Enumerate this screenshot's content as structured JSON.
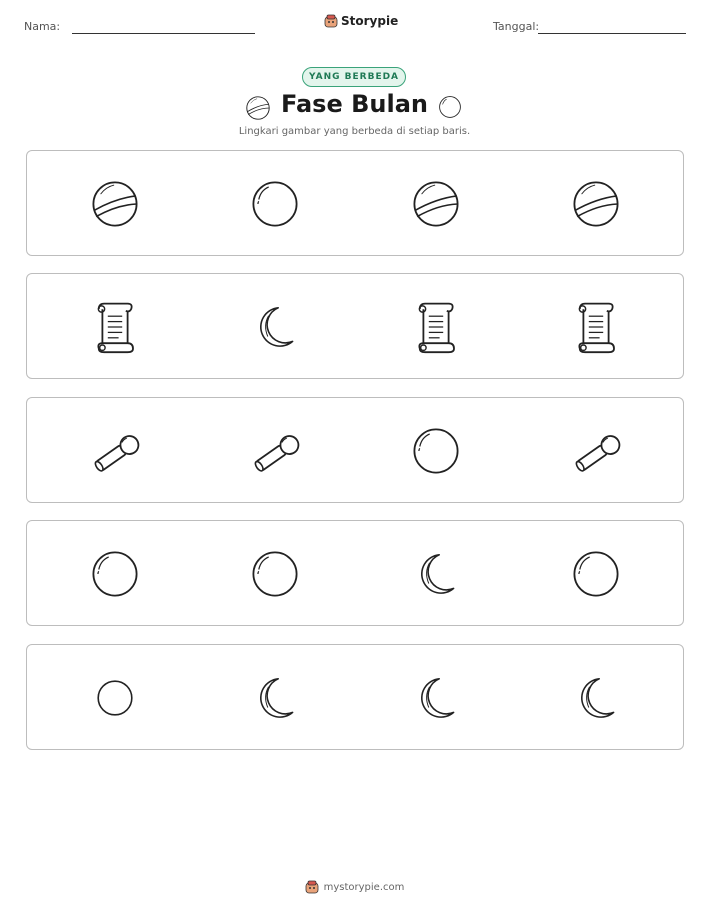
{
  "header": {
    "name_label": "Nama:",
    "brand": "Storypie",
    "date_label": "Tanggal:"
  },
  "badge": "YANG BERBEDA",
  "title": "Fase Bulan",
  "title_icons": [
    "ball-icon",
    "bubble-icon"
  ],
  "instruction": "Lingkari gambar yang berbeda di setiap baris.",
  "rows": [
    [
      "ball-icon",
      "bubble-icon",
      "ball-icon",
      "ball-icon"
    ],
    [
      "scroll-icon",
      "crescent-moon-icon",
      "scroll-icon",
      "scroll-icon"
    ],
    [
      "microphone-icon",
      "microphone-icon",
      "bubble-icon",
      "microphone-icon"
    ],
    [
      "bubble-icon",
      "bubble-icon",
      "crescent-moon-icon",
      "bubble-icon"
    ],
    [
      "full-moon-icon",
      "crescent-moon-icon",
      "crescent-moon-icon",
      "crescent-moon-icon"
    ]
  ],
  "footer": {
    "url": "mystorypie.com"
  }
}
